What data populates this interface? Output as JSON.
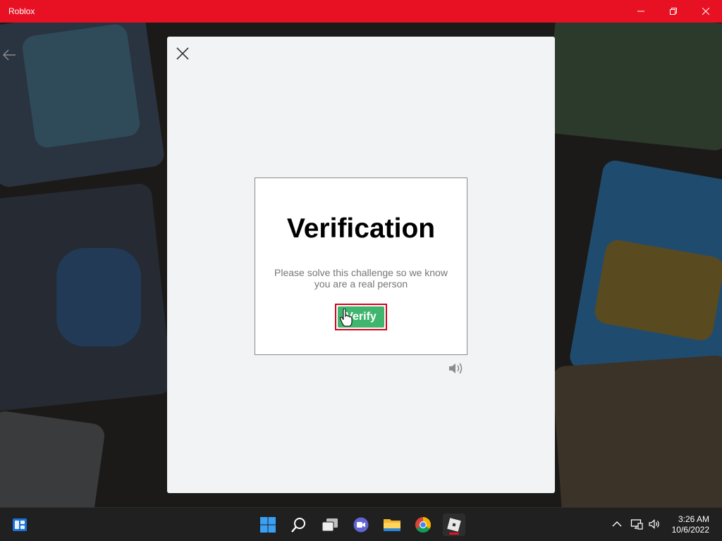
{
  "window": {
    "title": "Roblox",
    "accent_color": "#e81123"
  },
  "modal": {
    "close_icon": "close-icon",
    "captcha": {
      "title": "Verification",
      "description": "Please solve this challenge so we know you are a real person",
      "verify_label": "Verify",
      "verify_color": "#3fb56d",
      "audio_icon": "speaker-icon"
    }
  },
  "taskbar": {
    "icons": [
      "widgets-icon",
      "start-icon",
      "search-icon",
      "task-view-icon",
      "teams-chat-icon",
      "file-explorer-icon",
      "chrome-icon",
      "roblox-icon"
    ],
    "tray_icons": [
      "chevron-up-icon",
      "network-icon",
      "volume-icon"
    ],
    "time": "3:26 AM",
    "date": "10/6/2022"
  }
}
